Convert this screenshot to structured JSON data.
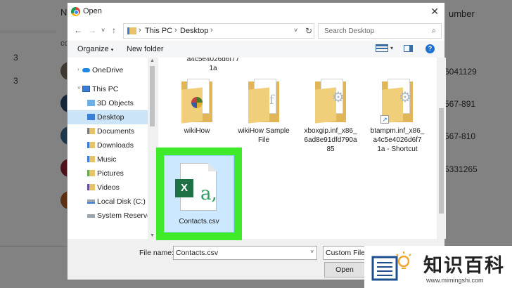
{
  "background": {
    "header_left": "N",
    "header_right": "umber",
    "sub_label": "co",
    "counts": [
      "3",
      "3"
    ],
    "phone_numbers": [
      "6041129",
      "567-891",
      "567-810",
      "5331265"
    ]
  },
  "dialog": {
    "title": "Open",
    "close_glyph": "✕",
    "nav": {
      "back": "←",
      "forward": "→",
      "recent": "˅",
      "up": "↑",
      "breadcrumbs": [
        "This PC",
        "Desktop"
      ],
      "search_placeholder": "Search Desktop"
    },
    "toolbar": {
      "organize": "Organize",
      "new_folder": "New folder"
    },
    "navpane": [
      {
        "label": "OneDrive",
        "icon": "onedrive-icon",
        "expand": "›"
      },
      {
        "label": "This PC",
        "icon": "pc-icon",
        "expand": "˅"
      },
      {
        "label": "3D Objects",
        "icon": "3d-objects-icon"
      },
      {
        "label": "Desktop",
        "icon": "desktop-icon",
        "selected": true
      },
      {
        "label": "Documents",
        "icon": "documents-icon"
      },
      {
        "label": "Downloads",
        "icon": "downloads-icon"
      },
      {
        "label": "Music",
        "icon": "music-icon"
      },
      {
        "label": "Pictures",
        "icon": "pictures-icon"
      },
      {
        "label": "Videos",
        "icon": "videos-icon"
      },
      {
        "label": "Local Disk (C:)",
        "icon": "disk-icon"
      },
      {
        "label": "System Reserved",
        "icon": "disk-icon"
      }
    ],
    "files": {
      "top_partial": [
        "a4c5e4026d6f77",
        "1a"
      ],
      "items": [
        {
          "label_lines": [
            "wikiHow"
          ],
          "type": "folder"
        },
        {
          "label_lines": [
            "wikiHow Sample",
            "File"
          ],
          "type": "folder"
        },
        {
          "label_lines": [
            "xboxgip.inf_x86_",
            "6ad8e91dfd790a",
            "85"
          ],
          "type": "folder"
        },
        {
          "label_lines": [
            "btampm.inf_x86_",
            "a4c5e4026d6f7",
            "1a - Shortcut"
          ],
          "type": "folder-shortcut"
        }
      ],
      "selected_file": {
        "label": "Contacts.csv",
        "x_glyph": "X",
        "a_glyph": "a,"
      }
    },
    "bottom": {
      "file_name_label": "File name:",
      "file_name_value": "Contacts.csv",
      "filter_value": "Custom Files",
      "open_label": "Open"
    }
  },
  "watermark": {
    "text": "知识百科",
    "url": "www.mimingshi.com"
  },
  "colors": {
    "highlight": "#3eea2a",
    "selection": "#cce8ff",
    "excel_green": "#1e7145"
  }
}
